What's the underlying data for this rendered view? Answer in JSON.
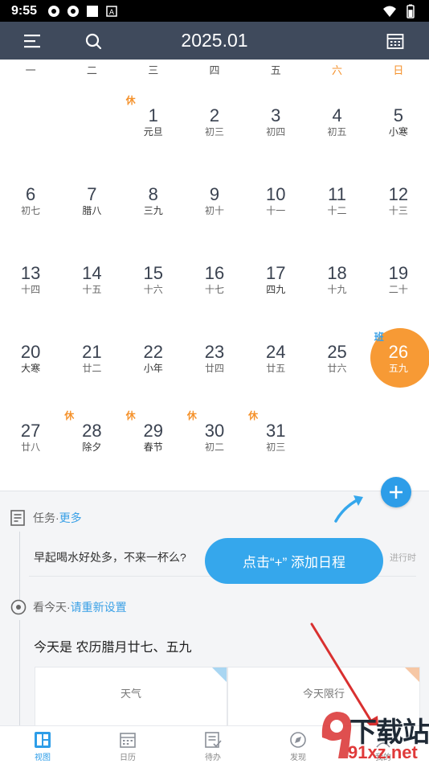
{
  "status_bar": {
    "time": "9:55",
    "battery_level_percent": 80
  },
  "header": {
    "title": "2025.01",
    "menu_icon": "menu-icon",
    "search_icon": "search-icon",
    "calendar_icon": "calendar-icon"
  },
  "weekdays": [
    "一",
    "二",
    "三",
    "四",
    "五",
    "六",
    "日"
  ],
  "weeks": [
    [
      null,
      null,
      {
        "day": "1",
        "lunar": "元旦",
        "festival": true,
        "tag": "休",
        "tag_type": "off"
      },
      {
        "day": "2",
        "lunar": "初三"
      },
      {
        "day": "3",
        "lunar": "初四"
      },
      {
        "day": "4",
        "lunar": "初五"
      },
      {
        "day": "5",
        "lunar": "小寒",
        "festival": true
      }
    ],
    [
      {
        "day": "6",
        "lunar": "初七"
      },
      {
        "day": "7",
        "lunar": "腊八",
        "festival": true
      },
      {
        "day": "8",
        "lunar": "三九",
        "festival": true
      },
      {
        "day": "9",
        "lunar": "初十"
      },
      {
        "day": "10",
        "lunar": "十一"
      },
      {
        "day": "11",
        "lunar": "十二"
      },
      {
        "day": "12",
        "lunar": "十三"
      }
    ],
    [
      {
        "day": "13",
        "lunar": "十四"
      },
      {
        "day": "14",
        "lunar": "十五"
      },
      {
        "day": "15",
        "lunar": "十六"
      },
      {
        "day": "16",
        "lunar": "十七"
      },
      {
        "day": "17",
        "lunar": "四九",
        "festival": true
      },
      {
        "day": "18",
        "lunar": "十九"
      },
      {
        "day": "19",
        "lunar": "二十"
      }
    ],
    [
      {
        "day": "20",
        "lunar": "大寒",
        "festival": true
      },
      {
        "day": "21",
        "lunar": "廿二"
      },
      {
        "day": "22",
        "lunar": "小年",
        "festival": true
      },
      {
        "day": "23",
        "lunar": "廿四"
      },
      {
        "day": "24",
        "lunar": "廿五"
      },
      {
        "day": "25",
        "lunar": "廿六"
      },
      {
        "day": "26",
        "lunar": "五九",
        "tag": "班",
        "tag_type": "work",
        "selected": true
      }
    ],
    [
      {
        "day": "27",
        "lunar": "廿八"
      },
      {
        "day": "28",
        "lunar": "除夕",
        "festival": true,
        "tag": "休",
        "tag_type": "off"
      },
      {
        "day": "29",
        "lunar": "春节",
        "festival": true,
        "tag": "休",
        "tag_type": "off"
      },
      {
        "day": "30",
        "lunar": "初二",
        "tag": "休",
        "tag_type": "off"
      },
      {
        "day": "31",
        "lunar": "初三",
        "tag": "休",
        "tag_type": "off"
      },
      null,
      null
    ]
  ],
  "tasks": {
    "heading": "任务",
    "separator": " · ",
    "more_link": "更多",
    "item_text": "早起喝水好处多，不来一杯么?",
    "item_status": "进行时"
  },
  "hint": {
    "label": "点击“+” 添加日程"
  },
  "today": {
    "heading": "看今天",
    "separator": " · ",
    "reset_link": "请重新设置",
    "summary": "今天是 农历腊月廿七、五九"
  },
  "cards": [
    {
      "label": "天气",
      "corner_color": "#a9d6f2"
    },
    {
      "label": "今天限行",
      "corner_color": "#f6c7a5"
    }
  ],
  "bottom_nav": [
    {
      "label": "视图",
      "icon": "view-grid-icon",
      "active": true
    },
    {
      "label": "日历",
      "icon": "calendar-icon"
    },
    {
      "label": "待办",
      "icon": "todo-icon"
    },
    {
      "label": "发现",
      "icon": "discover-icon"
    },
    {
      "label": "我的",
      "icon": "user-icon"
    }
  ],
  "watermark": {
    "big": "下载站",
    "small": "91xz.net"
  },
  "colors": {
    "accent": "#2d9de8",
    "header_bg": "#3f4a5c",
    "selected": "#f79a35",
    "weekend": "#f5922c"
  }
}
